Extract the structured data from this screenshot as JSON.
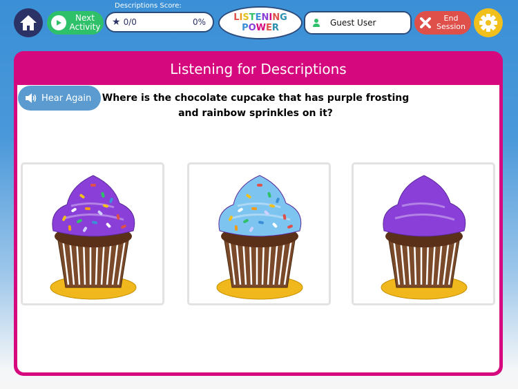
{
  "toolbar": {
    "home_icon": "home-icon",
    "next_activity_label_1": "Next",
    "next_activity_label_2": "Activity",
    "score_label": "Descriptions Score:",
    "score_value": "0/0",
    "score_percent": "0%",
    "logo_line1": [
      "L",
      "I",
      "S",
      "T",
      "E",
      "N",
      "I",
      "N",
      "G"
    ],
    "logo_line2": [
      "P",
      "O",
      "W",
      "E",
      "R"
    ],
    "user_name": "Guest User",
    "end_session_label_1": "End",
    "end_session_label_2": "Session",
    "settings_icon": "gear-icon"
  },
  "colors": {
    "panel": "#d6087e",
    "next": "#2fc06a",
    "end": "#e0504a",
    "settings": "#f2c01c",
    "home": "#2b3366"
  },
  "panel": {
    "title": "Listening for Descriptions",
    "hear_again_label": "Hear Again",
    "question_line1": "Where is the chocolate cupcake that has purple frosting",
    "question_line2": "and rainbow sprinkles on it?"
  },
  "choices": [
    {
      "frosting": "purple",
      "frosting_color": "#8a3fd8",
      "sprinkles": true
    },
    {
      "frosting": "blue",
      "frosting_color": "#7ec4f0",
      "sprinkles": true
    },
    {
      "frosting": "purple",
      "frosting_color": "#8a3fd8",
      "sprinkles": false
    }
  ]
}
